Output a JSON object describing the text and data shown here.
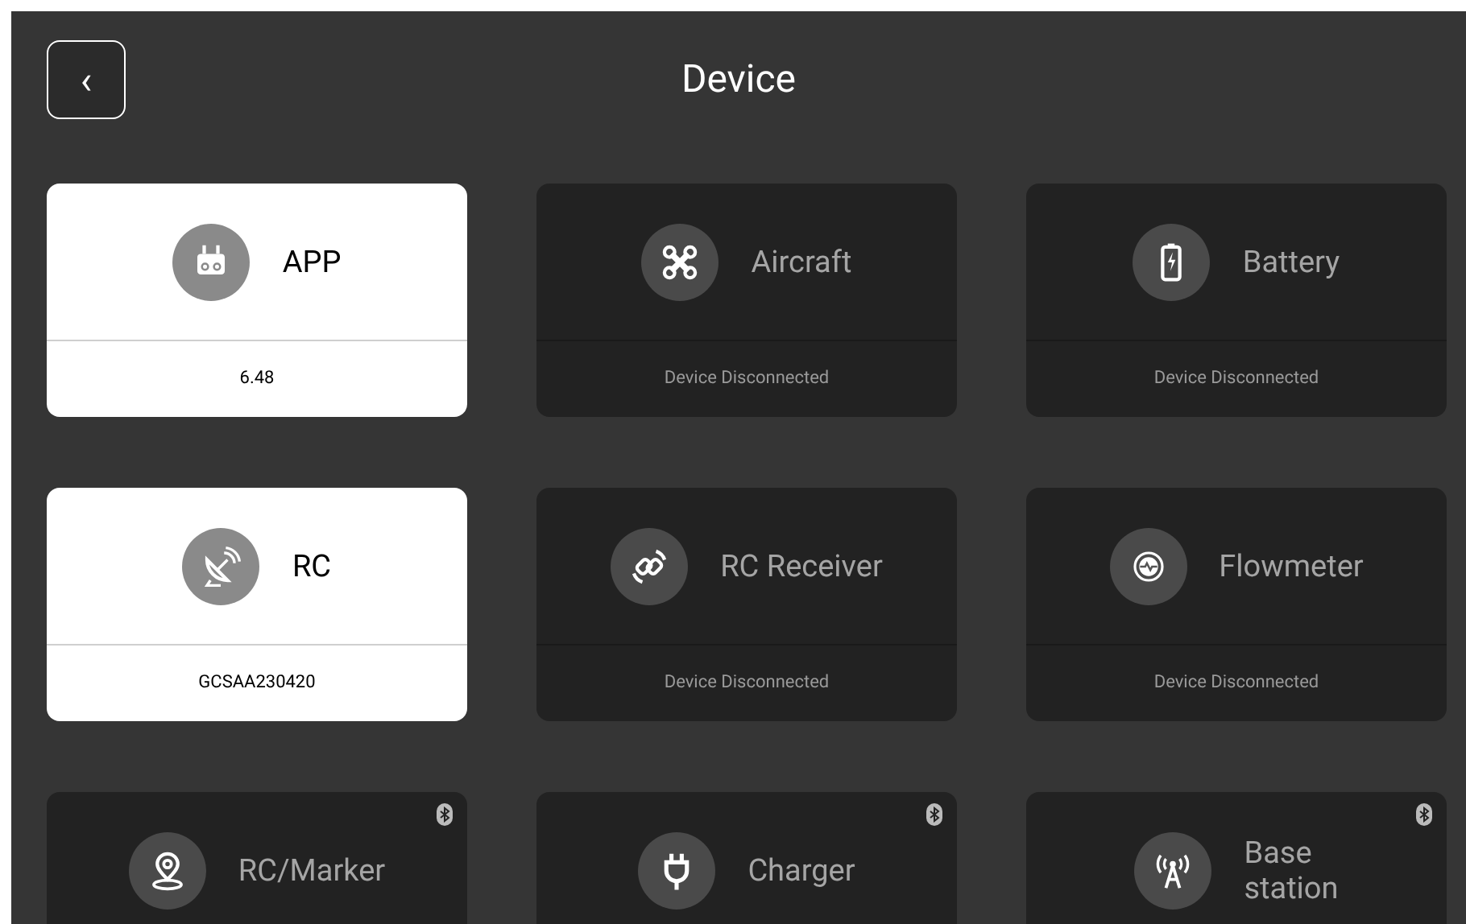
{
  "header": {
    "back": "‹",
    "title": "Device"
  },
  "devices": [
    {
      "label": "APP",
      "kind": "controller",
      "connected": true,
      "status": "6.48",
      "bluetooth": false
    },
    {
      "label": "Aircraft",
      "kind": "drone",
      "connected": false,
      "status": "Device Disconnected",
      "bluetooth": false
    },
    {
      "label": "Battery",
      "kind": "battery",
      "connected": false,
      "status": "Device Disconnected",
      "bluetooth": false
    },
    {
      "label": "RC",
      "kind": "dish",
      "connected": true,
      "status": "GCSAA230420",
      "bluetooth": false
    },
    {
      "label": "RC Receiver",
      "kind": "link",
      "connected": false,
      "status": "Device Disconnected",
      "bluetooth": false
    },
    {
      "label": "Flowmeter",
      "kind": "flow",
      "connected": false,
      "status": "Device Disconnected",
      "bluetooth": false
    },
    {
      "label": "RC/Marker",
      "kind": "pin",
      "connected": false,
      "bluetooth": true
    },
    {
      "label": "Charger",
      "kind": "plug",
      "connected": false,
      "bluetooth": true
    },
    {
      "label": "Base\nstation",
      "kind": "antenna",
      "connected": false,
      "bluetooth": true
    }
  ]
}
